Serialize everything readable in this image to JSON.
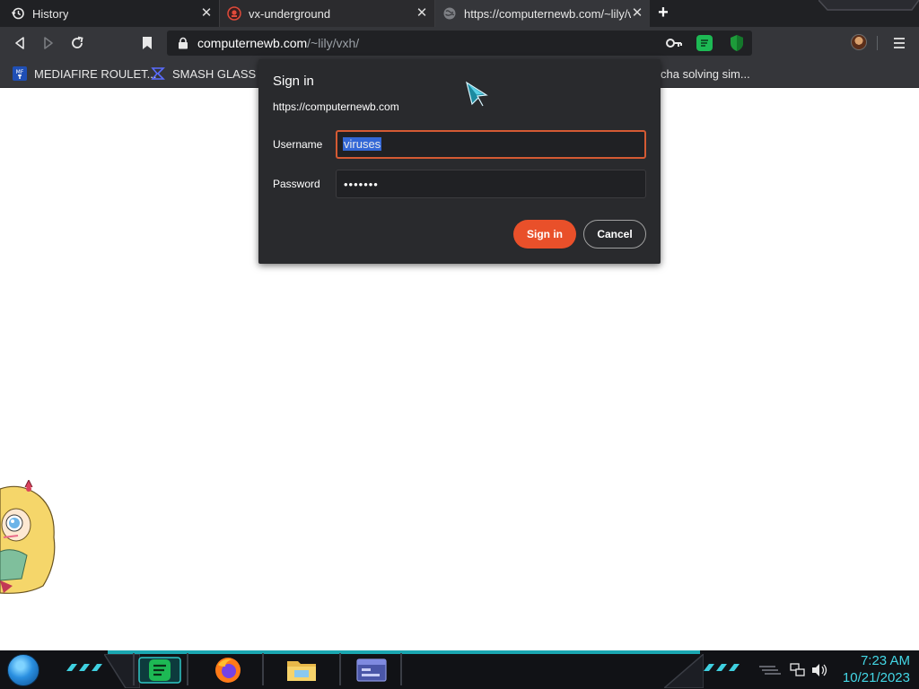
{
  "browser": {
    "tabs": [
      {
        "title": "History",
        "icon": "history-icon"
      },
      {
        "title": "vx-underground",
        "icon": "vx-favicon"
      },
      {
        "title": "https://computernewb.com/~lily/v",
        "icon": "globe-icon"
      }
    ],
    "new_tab_label": "+",
    "address": {
      "host": "computernewb.com",
      "path": "/~lily/vxh/"
    },
    "bookmarks": [
      {
        "label": "MEDIAFIRE ROULET...",
        "icon": "mediafire-icon"
      },
      {
        "label": "SMASH GLASS IN",
        "icon": "smash-icon"
      },
      {
        "label": "cha solving sim..."
      }
    ]
  },
  "dialog": {
    "title": "Sign in",
    "origin": "https://computernewb.com",
    "username_label": "Username",
    "username_value": "viruses",
    "password_label": "Password",
    "password_value": "•••••••",
    "signin_label": "Sign in",
    "cancel_label": "Cancel"
  },
  "taskbar": {
    "apps": [
      "spotify-icon",
      "firefox-icon",
      "file-explorer-icon",
      "window-icon"
    ],
    "clock_time": "7:23 AM",
    "clock_date": "10/21/2023"
  },
  "colors": {
    "accent": "#e9502a",
    "focus_border": "#d45a33",
    "selection": "#3367d6",
    "clock": "#43d7e6",
    "taskbar_accent": "#1aa6b0"
  }
}
